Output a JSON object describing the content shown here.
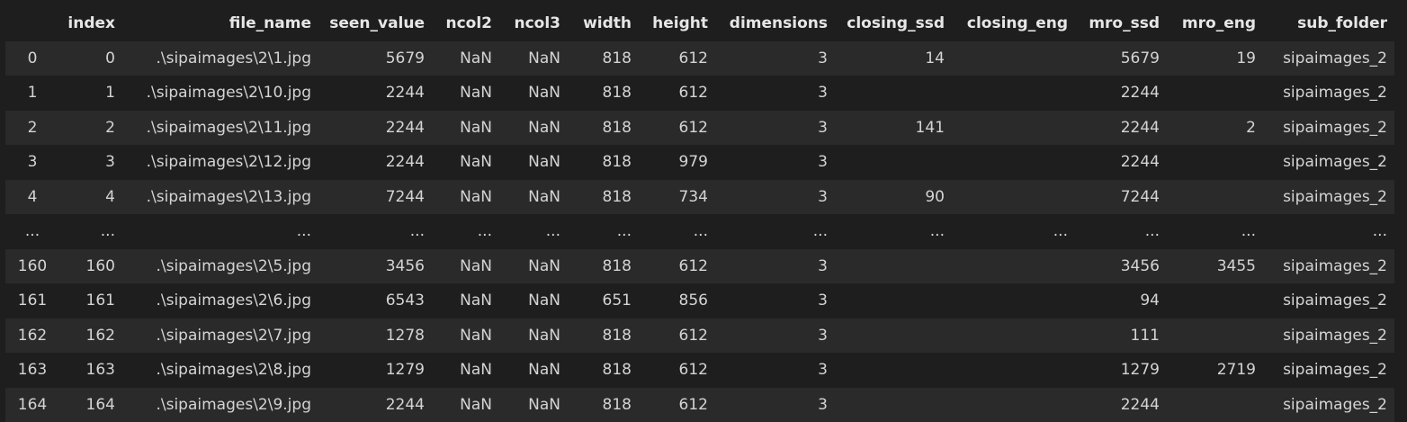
{
  "dataframe": {
    "columns": [
      "",
      "index",
      "file_name",
      "seen_value",
      "ncol2",
      "ncol3",
      "width",
      "height",
      "dimensions",
      "closing_ssd",
      "closing_eng",
      "mro_ssd",
      "mro_eng",
      "sub_folder"
    ],
    "rows": [
      {
        "label": "0",
        "cells": [
          "0",
          ".\\sipaimages\\2\\1.jpg",
          "5679",
          "NaN",
          "NaN",
          "818",
          "612",
          "3",
          "14",
          "",
          "5679",
          "19",
          "sipaimages_2"
        ]
      },
      {
        "label": "1",
        "cells": [
          "1",
          ".\\sipaimages\\2\\10.jpg",
          "2244",
          "NaN",
          "NaN",
          "818",
          "612",
          "3",
          "",
          "",
          "2244",
          "",
          "sipaimages_2"
        ]
      },
      {
        "label": "2",
        "cells": [
          "2",
          ".\\sipaimages\\2\\11.jpg",
          "2244",
          "NaN",
          "NaN",
          "818",
          "612",
          "3",
          "141",
          "",
          "2244",
          "2",
          "sipaimages_2"
        ]
      },
      {
        "label": "3",
        "cells": [
          "3",
          ".\\sipaimages\\2\\12.jpg",
          "2244",
          "NaN",
          "NaN",
          "818",
          "979",
          "3",
          "",
          "",
          "2244",
          "",
          "sipaimages_2"
        ]
      },
      {
        "label": "4",
        "cells": [
          "4",
          ".\\sipaimages\\2\\13.jpg",
          "7244",
          "NaN",
          "NaN",
          "818",
          "734",
          "3",
          "90",
          "",
          "7244",
          "",
          "sipaimages_2"
        ]
      },
      {
        "label": "...",
        "cells": [
          "...",
          "...",
          "...",
          "...",
          "...",
          "...",
          "...",
          "...",
          "...",
          "...",
          "...",
          "...",
          "..."
        ]
      },
      {
        "label": "160",
        "cells": [
          "160",
          ".\\sipaimages\\2\\5.jpg",
          "3456",
          "NaN",
          "NaN",
          "818",
          "612",
          "3",
          "",
          "",
          "3456",
          "3455",
          "sipaimages_2"
        ]
      },
      {
        "label": "161",
        "cells": [
          "161",
          ".\\sipaimages\\2\\6.jpg",
          "6543",
          "NaN",
          "NaN",
          "651",
          "856",
          "3",
          "",
          "",
          "94",
          "",
          "sipaimages_2"
        ]
      },
      {
        "label": "162",
        "cells": [
          "162",
          ".\\sipaimages\\2\\7.jpg",
          "1278",
          "NaN",
          "NaN",
          "818",
          "612",
          "3",
          "",
          "",
          "111",
          "",
          "sipaimages_2"
        ]
      },
      {
        "label": "163",
        "cells": [
          "163",
          ".\\sipaimages\\2\\8.jpg",
          "1279",
          "NaN",
          "NaN",
          "818",
          "612",
          "3",
          "",
          "",
          "1279",
          "2719",
          "sipaimages_2"
        ]
      },
      {
        "label": "164",
        "cells": [
          "164",
          ".\\sipaimages\\2\\9.jpg",
          "2244",
          "NaN",
          "NaN",
          "818",
          "612",
          "3",
          "",
          "",
          "2244",
          "",
          "sipaimages_2"
        ]
      }
    ]
  }
}
